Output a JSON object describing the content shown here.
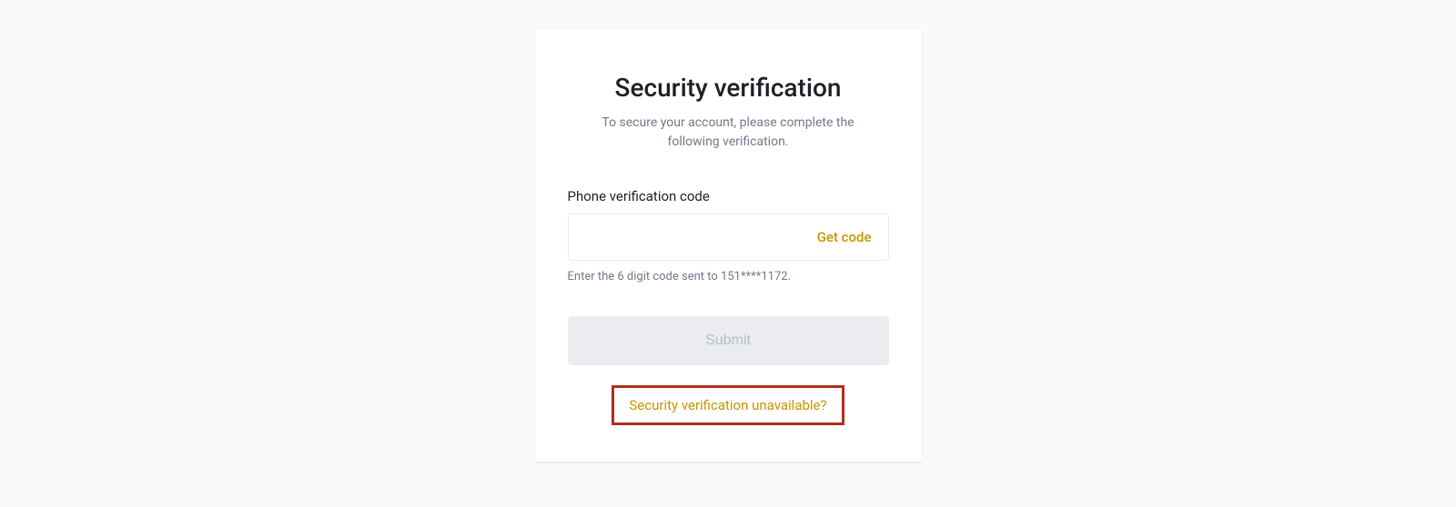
{
  "card": {
    "title": "Security verification",
    "subtitle": "To secure your account, please complete the following verification.",
    "phone_label": "Phone verification code",
    "get_code_label": "Get code",
    "hint": "Enter the 6 digit code sent to 151****1172.",
    "submit_label": "Submit",
    "unavailable_label": "Security verification unavailable?",
    "code_value": ""
  },
  "colors": {
    "accent": "#c99400",
    "highlight_border": "#b42c1d"
  }
}
